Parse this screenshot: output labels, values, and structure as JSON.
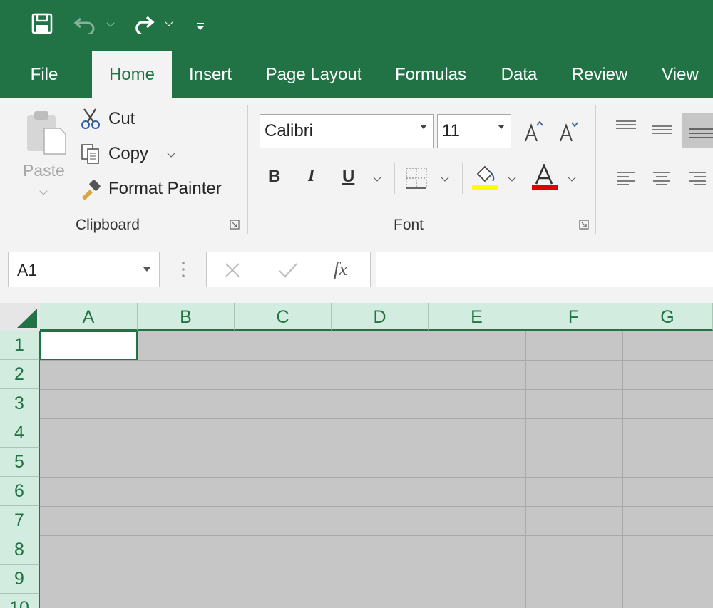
{
  "quick_access": {
    "save_icon": "save-icon",
    "undo_icon": "undo-icon",
    "redo_icon": "redo-icon",
    "customize_icon": "customize-qat-icon"
  },
  "tabs": [
    {
      "label": "File"
    },
    {
      "label": "Home"
    },
    {
      "label": "Insert"
    },
    {
      "label": "Page Layout"
    },
    {
      "label": "Formulas"
    },
    {
      "label": "Data"
    },
    {
      "label": "Review"
    },
    {
      "label": "View"
    }
  ],
  "active_tab": "Home",
  "clipboard": {
    "paste_label": "Paste",
    "cut_label": "Cut",
    "copy_label": "Copy",
    "format_painter_label": "Format Painter",
    "group_label": "Clipboard"
  },
  "font": {
    "font_name": "Calibri",
    "font_size": "11",
    "bold": "B",
    "italic": "I",
    "underline": "U",
    "group_label": "Font",
    "fill_color": "#ffff00",
    "font_color": "#e00000"
  },
  "formula_bar": {
    "name_box": "A1",
    "fx_label": "fx",
    "formula": ""
  },
  "sheet": {
    "columns": [
      "A",
      "B",
      "C",
      "D",
      "E",
      "F",
      "G"
    ],
    "rows": [
      "1",
      "2",
      "3",
      "4",
      "5",
      "6",
      "7",
      "8",
      "9",
      "10"
    ],
    "selected_cell": "A1"
  },
  "colors": {
    "accent": "#217346",
    "header_bg": "#d2ecdf"
  }
}
